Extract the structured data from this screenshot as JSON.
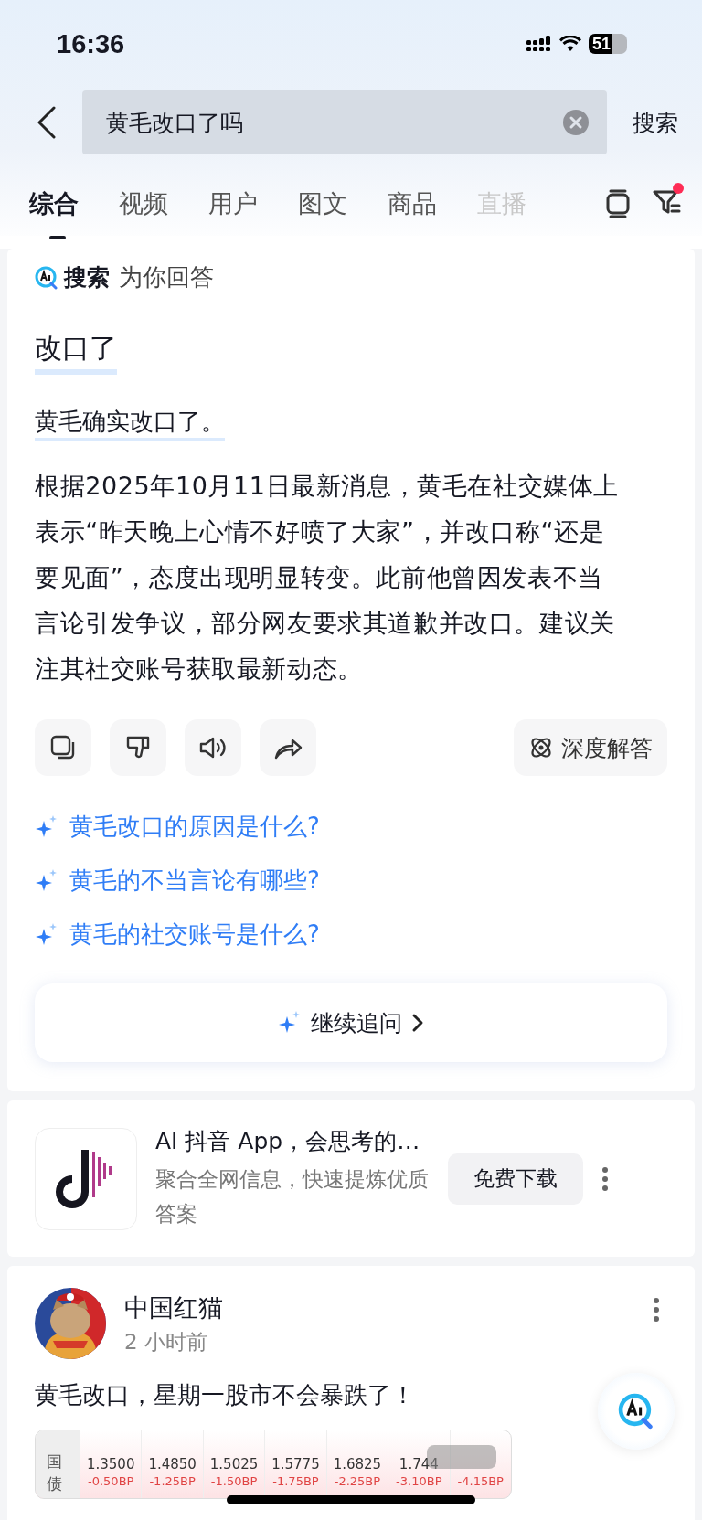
{
  "status_bar": {
    "time": "16:36",
    "battery": "51"
  },
  "search": {
    "value": "黄毛改口了吗",
    "submit": "搜索"
  },
  "tabs": [
    {
      "label": "综合",
      "selected": true
    },
    {
      "label": "视频",
      "selected": false
    },
    {
      "label": "用户",
      "selected": false
    },
    {
      "label": "图文",
      "selected": false
    },
    {
      "label": "商品",
      "selected": false
    },
    {
      "label": "直播",
      "selected": false
    }
  ],
  "filter": {
    "has_notification": true
  },
  "ai_answer": {
    "brand": "搜索",
    "subtitle": "为你回答",
    "heading": "改口了",
    "summary": "黄毛确实改口了。",
    "body": "根据2025年10月11日最新消息，黄毛在社交媒体上表示“昨天晚上心情不好喷了大家”，并改口称“还是要见面”，态度出现明显转变。此前他曾因发表不当言论引发争议，部分网友要求其道歉并改口。建议关注其社交账号获取最新动态。",
    "deep_button": "深度解答",
    "suggestions": [
      "黄毛改口的原因是什么?",
      "黄毛的不当言论有哪些?",
      "黄毛的社交账号是什么?"
    ],
    "continue_button": "继续追问"
  },
  "ad": {
    "title": "AI 抖音 App，会思考的…",
    "description": "聚合全网信息，快速提炼优质答案",
    "button": "免费下载"
  },
  "post": {
    "author": "中国红猫",
    "time": "2 小时前",
    "text": "黄毛改口，星期一股市不会暴跌了！",
    "table": {
      "row_label": "国债",
      "cells": [
        {
          "value": "1.3500",
          "change": "-0.50BP"
        },
        {
          "value": "1.4850",
          "change": "-1.25BP"
        },
        {
          "value": "1.5025",
          "change": "-1.50BP"
        },
        {
          "value": "1.5775",
          "change": "-1.75BP"
        },
        {
          "value": "1.6825",
          "change": "-2.25BP"
        },
        {
          "value": "1.744",
          "change": "-3.10BP"
        },
        {
          "change": "-4.15BP"
        }
      ]
    }
  }
}
